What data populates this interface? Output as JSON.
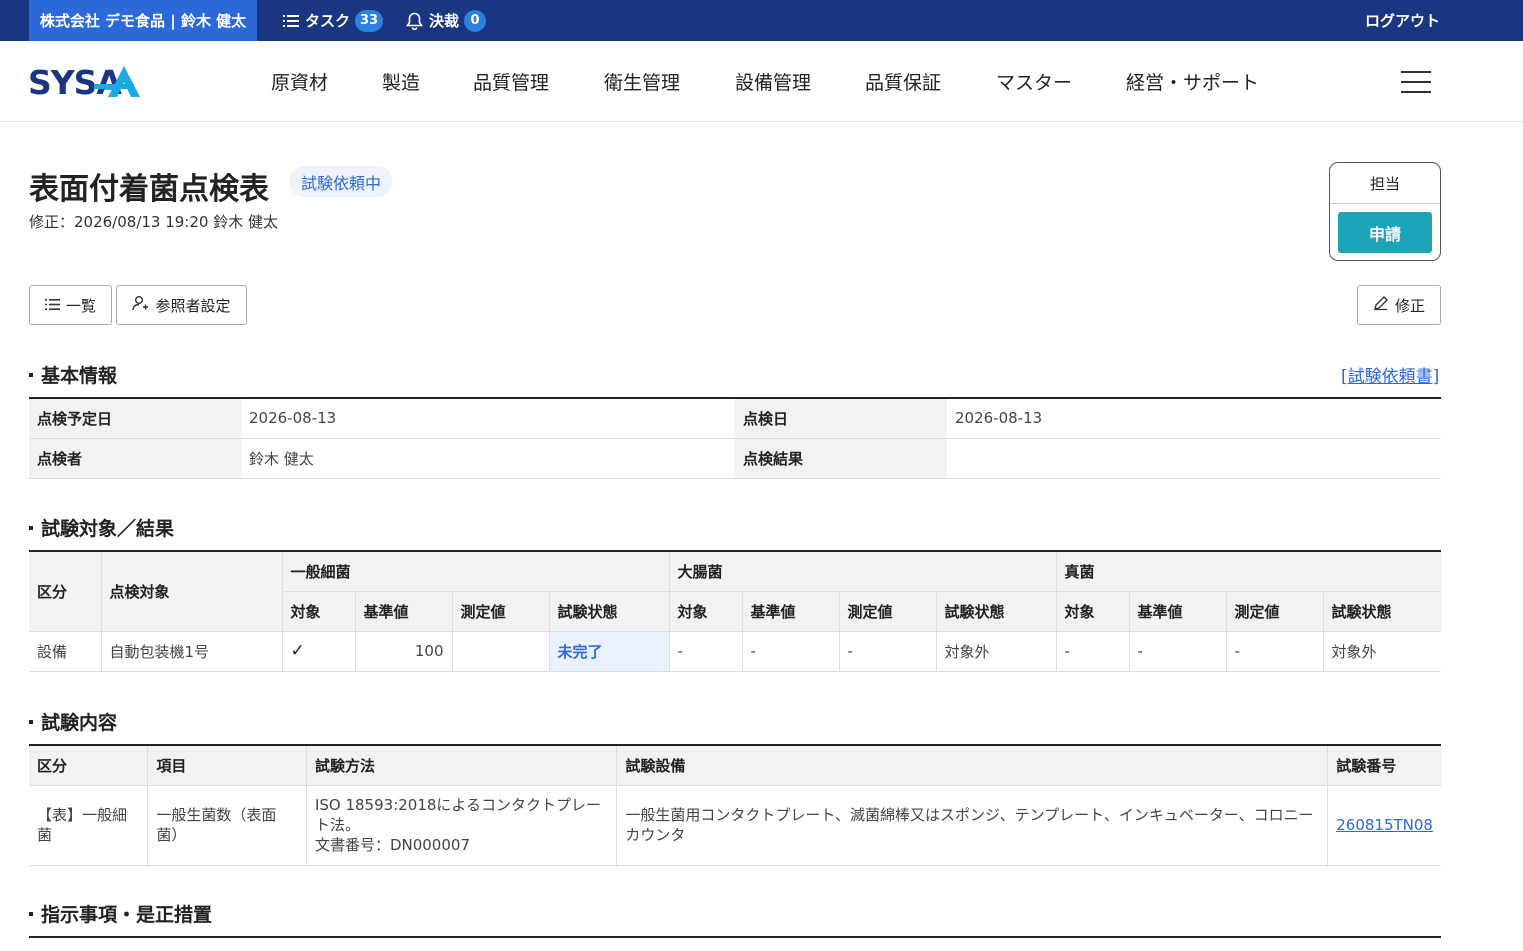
{
  "topbar": {
    "company": "株式会社 デモ食品 | 鈴木 健太",
    "task_label": "タスク",
    "task_count": "33",
    "approval_label": "決裁",
    "approval_count": "0",
    "logout": "ログアウト"
  },
  "header": {
    "logo": "SYSA",
    "nav": [
      "原資材",
      "製造",
      "品質管理",
      "衛生管理",
      "設備管理",
      "品質保証",
      "マスター",
      "経営・サポート"
    ]
  },
  "page": {
    "title": "表面付着菌点検表",
    "status": "試験依頼中",
    "modified": "修正：2026/08/13 19:20 鈴木 健太"
  },
  "approval": {
    "role": "担当",
    "apply_label": "申請"
  },
  "toolbar": {
    "list_label": "一覧",
    "viewer_label": "参照者設定",
    "edit_label": "修正"
  },
  "basic": {
    "section_title": "基本情報",
    "request_link": "[試験依頼書]",
    "scheduled_label": "点検予定日",
    "scheduled_value": "2026-08-13",
    "date_label": "点検日",
    "date_value": "2026-08-13",
    "inspector_label": "点検者",
    "inspector_value": "鈴木 健太",
    "result_label": "点検結果",
    "result_value": ""
  },
  "results": {
    "section_title": "試験対象／結果",
    "col_category": "区分",
    "col_target": "点検対象",
    "groups": [
      "一般細菌",
      "大腸菌",
      "真菌"
    ],
    "sub_headers": [
      "対象",
      "基準値",
      "測定値",
      "試験状態"
    ],
    "row": {
      "category": "設備",
      "target": "自動包装機1号",
      "g1": [
        "✓",
        "100",
        "",
        "未完了"
      ],
      "g2": [
        "-",
        "-",
        "-",
        "対象外"
      ],
      "g3": [
        "-",
        "-",
        "-",
        "対象外"
      ]
    }
  },
  "content": {
    "section_title": "試験内容",
    "headers": [
      "区分",
      "項目",
      "試験方法",
      "試験設備",
      "試験番号"
    ],
    "row": {
      "category": "【表】一般細菌",
      "item": "一般生菌数（表面菌）",
      "method": "ISO 18593:2018によるコンタクトプレート法。",
      "doc_no": "文書番号：DN000007",
      "equipment": "一般生菌用コンタクトプレート、滅菌綿棒又はスポンジ、テンプレート、インキュベーター、コロニーカウンタ",
      "test_no": "260815TN08"
    }
  },
  "instructions": {
    "section_title": "指示事項・是正措置"
  },
  "colors": {
    "topbar": "#1a3680",
    "company_bg": "#2c69d8",
    "accent": "#2c69d8",
    "apply_button": "#1da3b8"
  }
}
